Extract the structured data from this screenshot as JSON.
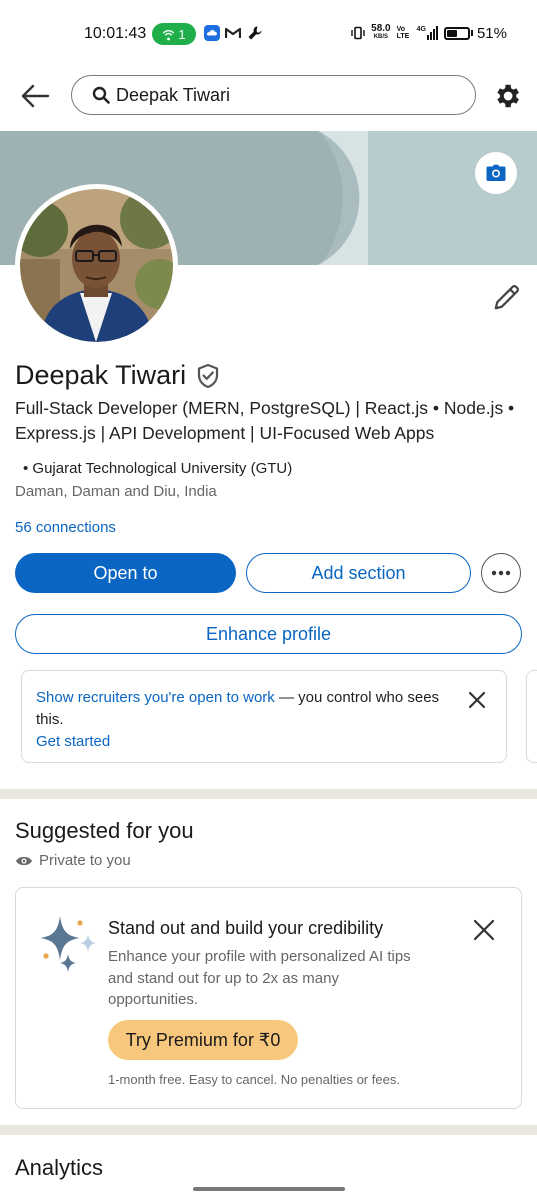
{
  "status_bar": {
    "time": "10:01:43",
    "hotspot_count": "1",
    "net_speed": "58.0",
    "net_unit": "KB/S",
    "volte": "Vo LTE",
    "network": "4G",
    "battery": "51%",
    "battery_level": 0.51
  },
  "header": {
    "search_value": "Deepak Tiwari"
  },
  "profile": {
    "name": "Deepak Tiwari",
    "headline": "Full-Stack Developer (MERN, PostgreSQL) | React.js • Node.js • Express.js | API Development | UI-Focused Web Apps",
    "education": "• Gujarat Technological University (GTU)",
    "location": "Daman, Daman and Diu, India",
    "connections": "56 connections"
  },
  "actions": {
    "open_to": "Open to",
    "add_section": "Add section",
    "enhance": "Enhance profile"
  },
  "open_to_work_card": {
    "link": "Show recruiters you're open to work",
    "text": " — you control who sees this.",
    "cta": "Get started"
  },
  "suggested": {
    "title": "Suggested for you",
    "visibility": "Private to you",
    "card": {
      "title": "Stand out and build your credibility",
      "body": "Enhance your profile with personalized AI tips and stand out for up to 2x as many opportunities.",
      "button": "Try Premium for ₹0",
      "note": "1-month free. Easy to cancel. No penalties or fees."
    }
  },
  "analytics": {
    "title": "Analytics"
  },
  "colors": {
    "brand_blue": "#0a66c2",
    "premium_gold": "#f8c77e",
    "banner": "#a9bcbf",
    "hotspot_green": "#1fae4a"
  }
}
